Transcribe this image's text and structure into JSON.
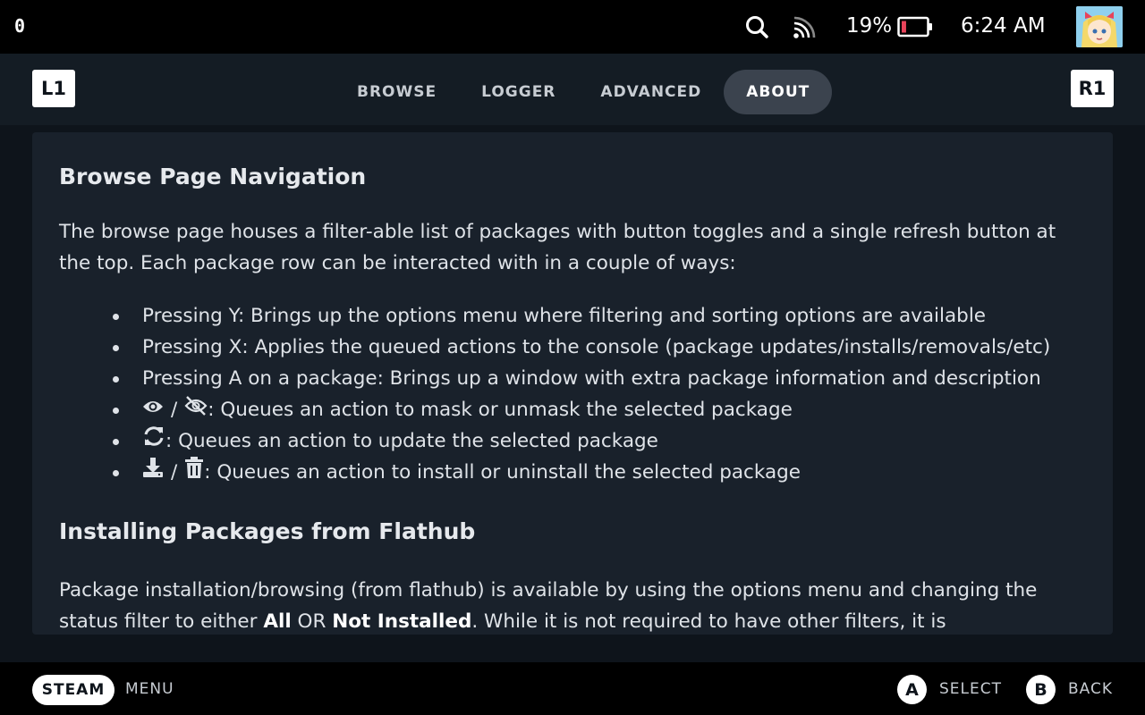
{
  "status_bar": {
    "left_glyph": "0",
    "battery_percent": "19%",
    "battery_level": 0.19,
    "time": "6:24 AM",
    "icons": [
      "search-icon",
      "wifi-icon",
      "battery-icon",
      "avatar"
    ]
  },
  "header": {
    "left_shoulder": "L1",
    "right_shoulder": "R1",
    "tabs": [
      {
        "label": "BROWSE",
        "active": false
      },
      {
        "label": "LOGGER",
        "active": false
      },
      {
        "label": "ADVANCED",
        "active": false
      },
      {
        "label": "ABOUT",
        "active": true
      }
    ]
  },
  "content": {
    "section1_title": "Browse Page Navigation",
    "section1_intro": "The browse page houses a filter-able list of packages with button toggles and a single refresh button at the top. Each package row can be interacted with in a couple of ways:",
    "bullets": [
      "Pressing Y: Brings up the options menu where filtering and sorting options are available",
      "Pressing X: Applies the queued actions to the console (package updates/installs/removals/etc)",
      "Pressing A on a package: Brings up a window with extra package information and description"
    ],
    "icon_bullets": {
      "mask_sep": "/",
      "mask_text": ": Queues an action to mask or unmask the selected package",
      "update_text": ": Queues an action to update the selected package",
      "install_sep": "/",
      "install_text": ": Queues an action to install or uninstall the selected package"
    },
    "section2_title": "Installing Packages from Flathub",
    "section2_p_part1": "Package installation/browsing (from flathub) is available by using the options menu and changing the status filter to either ",
    "section2_p_bold1": "All",
    "section2_p_part2": " OR ",
    "section2_p_bold2": "Not Installed",
    "section2_p_part3": ". While it is not required to have other filters, it is"
  },
  "bottom_bar": {
    "steam_label": "STEAM",
    "menu_label": "MENU",
    "a_button": "A",
    "select_label": "SELECT",
    "b_button": "B",
    "back_label": "BACK"
  },
  "colors": {
    "background": "#0e141b",
    "panel": "#19212b",
    "active_tab": "#3b434e",
    "battery_low": "#e8435a"
  }
}
